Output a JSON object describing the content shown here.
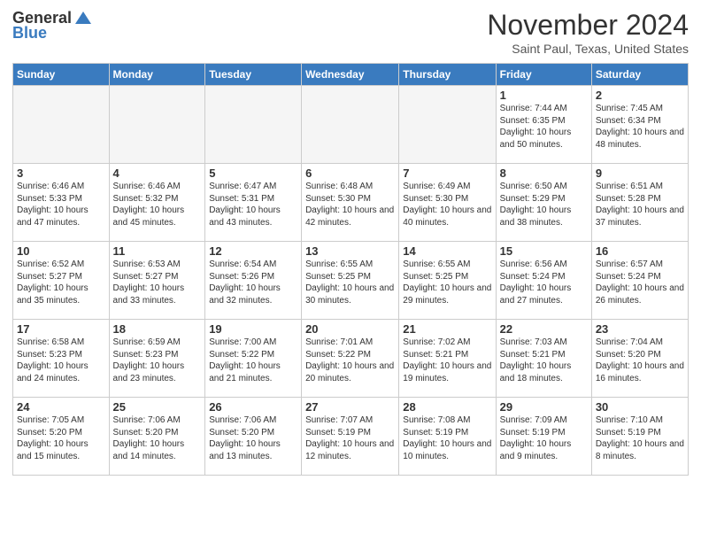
{
  "header": {
    "logo": {
      "line1": "General",
      "line2": "Blue"
    },
    "title": "November 2024",
    "location": "Saint Paul, Texas, United States"
  },
  "weekdays": [
    "Sunday",
    "Monday",
    "Tuesday",
    "Wednesday",
    "Thursday",
    "Friday",
    "Saturday"
  ],
  "weeks": [
    [
      {
        "day": "",
        "info": ""
      },
      {
        "day": "",
        "info": ""
      },
      {
        "day": "",
        "info": ""
      },
      {
        "day": "",
        "info": ""
      },
      {
        "day": "",
        "info": ""
      },
      {
        "day": "1",
        "info": "Sunrise: 7:44 AM\nSunset: 6:35 PM\nDaylight: 10 hours\nand 50 minutes."
      },
      {
        "day": "2",
        "info": "Sunrise: 7:45 AM\nSunset: 6:34 PM\nDaylight: 10 hours\nand 48 minutes."
      }
    ],
    [
      {
        "day": "3",
        "info": "Sunrise: 6:46 AM\nSunset: 5:33 PM\nDaylight: 10 hours\nand 47 minutes."
      },
      {
        "day": "4",
        "info": "Sunrise: 6:46 AM\nSunset: 5:32 PM\nDaylight: 10 hours\nand 45 minutes."
      },
      {
        "day": "5",
        "info": "Sunrise: 6:47 AM\nSunset: 5:31 PM\nDaylight: 10 hours\nand 43 minutes."
      },
      {
        "day": "6",
        "info": "Sunrise: 6:48 AM\nSunset: 5:30 PM\nDaylight: 10 hours\nand 42 minutes."
      },
      {
        "day": "7",
        "info": "Sunrise: 6:49 AM\nSunset: 5:30 PM\nDaylight: 10 hours\nand 40 minutes."
      },
      {
        "day": "8",
        "info": "Sunrise: 6:50 AM\nSunset: 5:29 PM\nDaylight: 10 hours\nand 38 minutes."
      },
      {
        "day": "9",
        "info": "Sunrise: 6:51 AM\nSunset: 5:28 PM\nDaylight: 10 hours\nand 37 minutes."
      }
    ],
    [
      {
        "day": "10",
        "info": "Sunrise: 6:52 AM\nSunset: 5:27 PM\nDaylight: 10 hours\nand 35 minutes."
      },
      {
        "day": "11",
        "info": "Sunrise: 6:53 AM\nSunset: 5:27 PM\nDaylight: 10 hours\nand 33 minutes."
      },
      {
        "day": "12",
        "info": "Sunrise: 6:54 AM\nSunset: 5:26 PM\nDaylight: 10 hours\nand 32 minutes."
      },
      {
        "day": "13",
        "info": "Sunrise: 6:55 AM\nSunset: 5:25 PM\nDaylight: 10 hours\nand 30 minutes."
      },
      {
        "day": "14",
        "info": "Sunrise: 6:55 AM\nSunset: 5:25 PM\nDaylight: 10 hours\nand 29 minutes."
      },
      {
        "day": "15",
        "info": "Sunrise: 6:56 AM\nSunset: 5:24 PM\nDaylight: 10 hours\nand 27 minutes."
      },
      {
        "day": "16",
        "info": "Sunrise: 6:57 AM\nSunset: 5:24 PM\nDaylight: 10 hours\nand 26 minutes."
      }
    ],
    [
      {
        "day": "17",
        "info": "Sunrise: 6:58 AM\nSunset: 5:23 PM\nDaylight: 10 hours\nand 24 minutes."
      },
      {
        "day": "18",
        "info": "Sunrise: 6:59 AM\nSunset: 5:23 PM\nDaylight: 10 hours\nand 23 minutes."
      },
      {
        "day": "19",
        "info": "Sunrise: 7:00 AM\nSunset: 5:22 PM\nDaylight: 10 hours\nand 21 minutes."
      },
      {
        "day": "20",
        "info": "Sunrise: 7:01 AM\nSunset: 5:22 PM\nDaylight: 10 hours\nand 20 minutes."
      },
      {
        "day": "21",
        "info": "Sunrise: 7:02 AM\nSunset: 5:21 PM\nDaylight: 10 hours\nand 19 minutes."
      },
      {
        "day": "22",
        "info": "Sunrise: 7:03 AM\nSunset: 5:21 PM\nDaylight: 10 hours\nand 18 minutes."
      },
      {
        "day": "23",
        "info": "Sunrise: 7:04 AM\nSunset: 5:20 PM\nDaylight: 10 hours\nand 16 minutes."
      }
    ],
    [
      {
        "day": "24",
        "info": "Sunrise: 7:05 AM\nSunset: 5:20 PM\nDaylight: 10 hours\nand 15 minutes."
      },
      {
        "day": "25",
        "info": "Sunrise: 7:06 AM\nSunset: 5:20 PM\nDaylight: 10 hours\nand 14 minutes."
      },
      {
        "day": "26",
        "info": "Sunrise: 7:06 AM\nSunset: 5:20 PM\nDaylight: 10 hours\nand 13 minutes."
      },
      {
        "day": "27",
        "info": "Sunrise: 7:07 AM\nSunset: 5:19 PM\nDaylight: 10 hours\nand 12 minutes."
      },
      {
        "day": "28",
        "info": "Sunrise: 7:08 AM\nSunset: 5:19 PM\nDaylight: 10 hours\nand 10 minutes."
      },
      {
        "day": "29",
        "info": "Sunrise: 7:09 AM\nSunset: 5:19 PM\nDaylight: 10 hours\nand 9 minutes."
      },
      {
        "day": "30",
        "info": "Sunrise: 7:10 AM\nSunset: 5:19 PM\nDaylight: 10 hours\nand 8 minutes."
      }
    ]
  ]
}
